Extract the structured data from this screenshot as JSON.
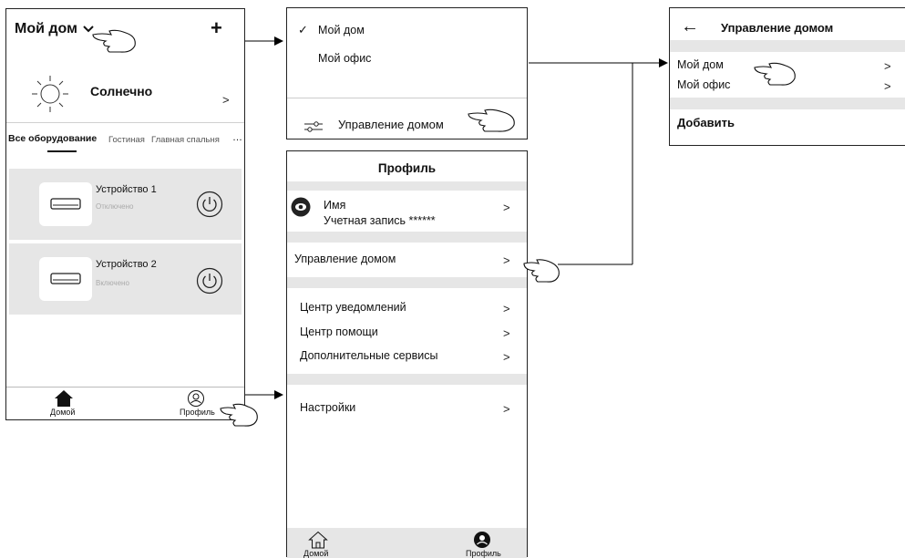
{
  "home": {
    "title": "Мой дом",
    "add_label": "+",
    "weather": "Солнечно",
    "weather_chevron": ">",
    "tab_active": "Все оборудование",
    "tab_2": "Гостиная",
    "tab_3": "Главная спальня",
    "tab_more": "…",
    "devices": [
      {
        "name": "Устройство 1",
        "status": "Отключено"
      },
      {
        "name": "Устройство 2",
        "status": "Включено"
      }
    ],
    "nav_home": "Домой",
    "nav_profile": "Профиль"
  },
  "dropdown": {
    "check": "✓",
    "item_1": "Мой дом",
    "item_2": "Мой офис",
    "manage": "Управление домом"
  },
  "profile": {
    "title": "Профиль",
    "name_label": "Имя",
    "account_label": "Учетная запись ******",
    "manage_home": "Управление домом",
    "notifications": "Центр уведомлений",
    "help": "Центр помощи",
    "services": "Дополнительные сервисы",
    "settings": "Настройки",
    "chevron": ">",
    "nav_home": "Домой",
    "nav_profile": "Профиль"
  },
  "manage_home": {
    "back": "←",
    "title": "Управление домом",
    "item_1": "Мой дом",
    "item_2": "Мой офис",
    "add": "Добавить",
    "chevron": ">"
  },
  "colors": {
    "card_bg": "#e6e6e6",
    "border": "#222222"
  }
}
